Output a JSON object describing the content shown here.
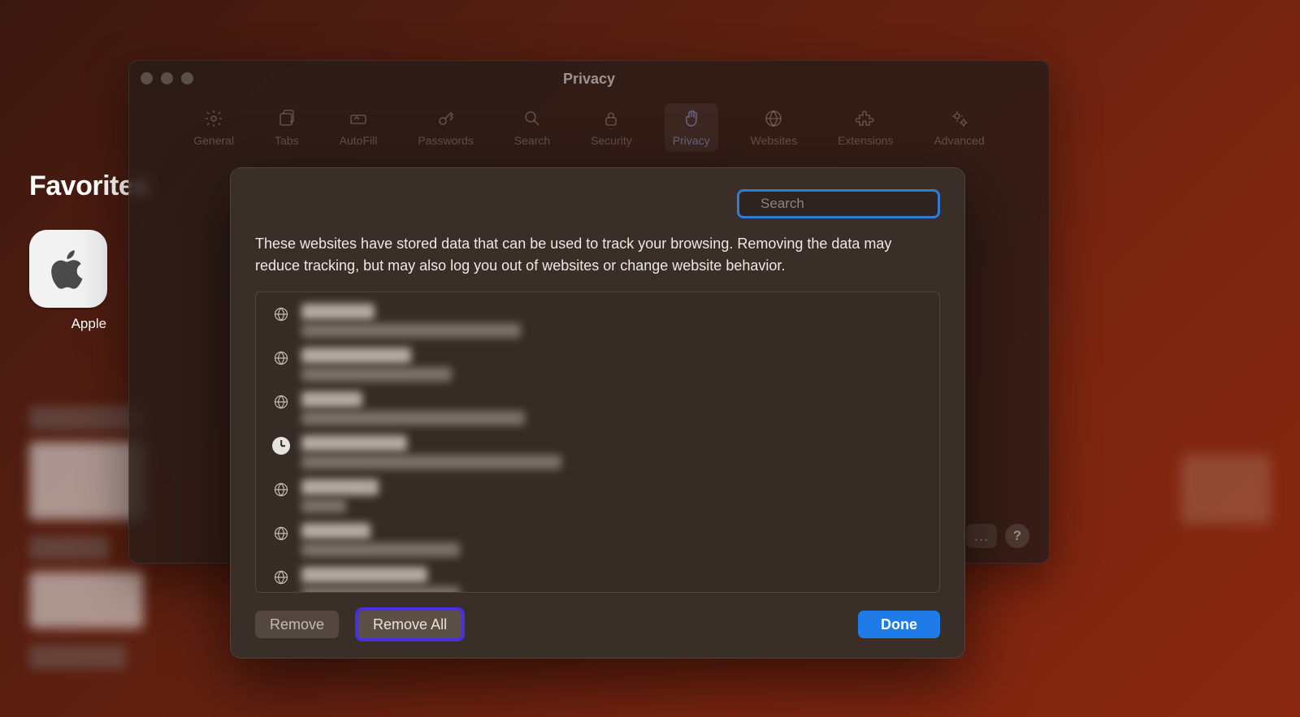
{
  "background": {
    "favorites_title": "Favorites",
    "tile_label": "Apple"
  },
  "prefs": {
    "title": "Privacy",
    "tabs": [
      {
        "id": "general",
        "label": "General"
      },
      {
        "id": "tabs",
        "label": "Tabs"
      },
      {
        "id": "autofill",
        "label": "AutoFill"
      },
      {
        "id": "passwords",
        "label": "Passwords"
      },
      {
        "id": "search",
        "label": "Search"
      },
      {
        "id": "security",
        "label": "Security"
      },
      {
        "id": "privacy",
        "label": "Privacy"
      },
      {
        "id": "websites",
        "label": "Websites"
      },
      {
        "id": "extensions",
        "label": "Extensions"
      },
      {
        "id": "advanced",
        "label": "Advanced"
      }
    ],
    "active_tab": "privacy",
    "help": "?",
    "ellipsis": "..."
  },
  "sheet": {
    "search_placeholder": "Search",
    "description": "These websites have stored data that can be used to track your browsing. Removing the data may reduce tracking, but may also log you out of websites or change website behavior.",
    "rows": [
      {
        "icon": "globe",
        "tw": 90,
        "sw": 270
      },
      {
        "icon": "globe",
        "tw": 135,
        "sw": 185
      },
      {
        "icon": "globe",
        "tw": 75,
        "sw": 275
      },
      {
        "icon": "clock",
        "tw": 130,
        "sw": 320
      },
      {
        "icon": "globe",
        "tw": 95,
        "sw": 55
      },
      {
        "icon": "globe",
        "tw": 85,
        "sw": 195
      },
      {
        "icon": "globe",
        "tw": 155,
        "sw": 195
      }
    ],
    "remove": "Remove",
    "remove_all": "Remove All",
    "done": "Done"
  }
}
